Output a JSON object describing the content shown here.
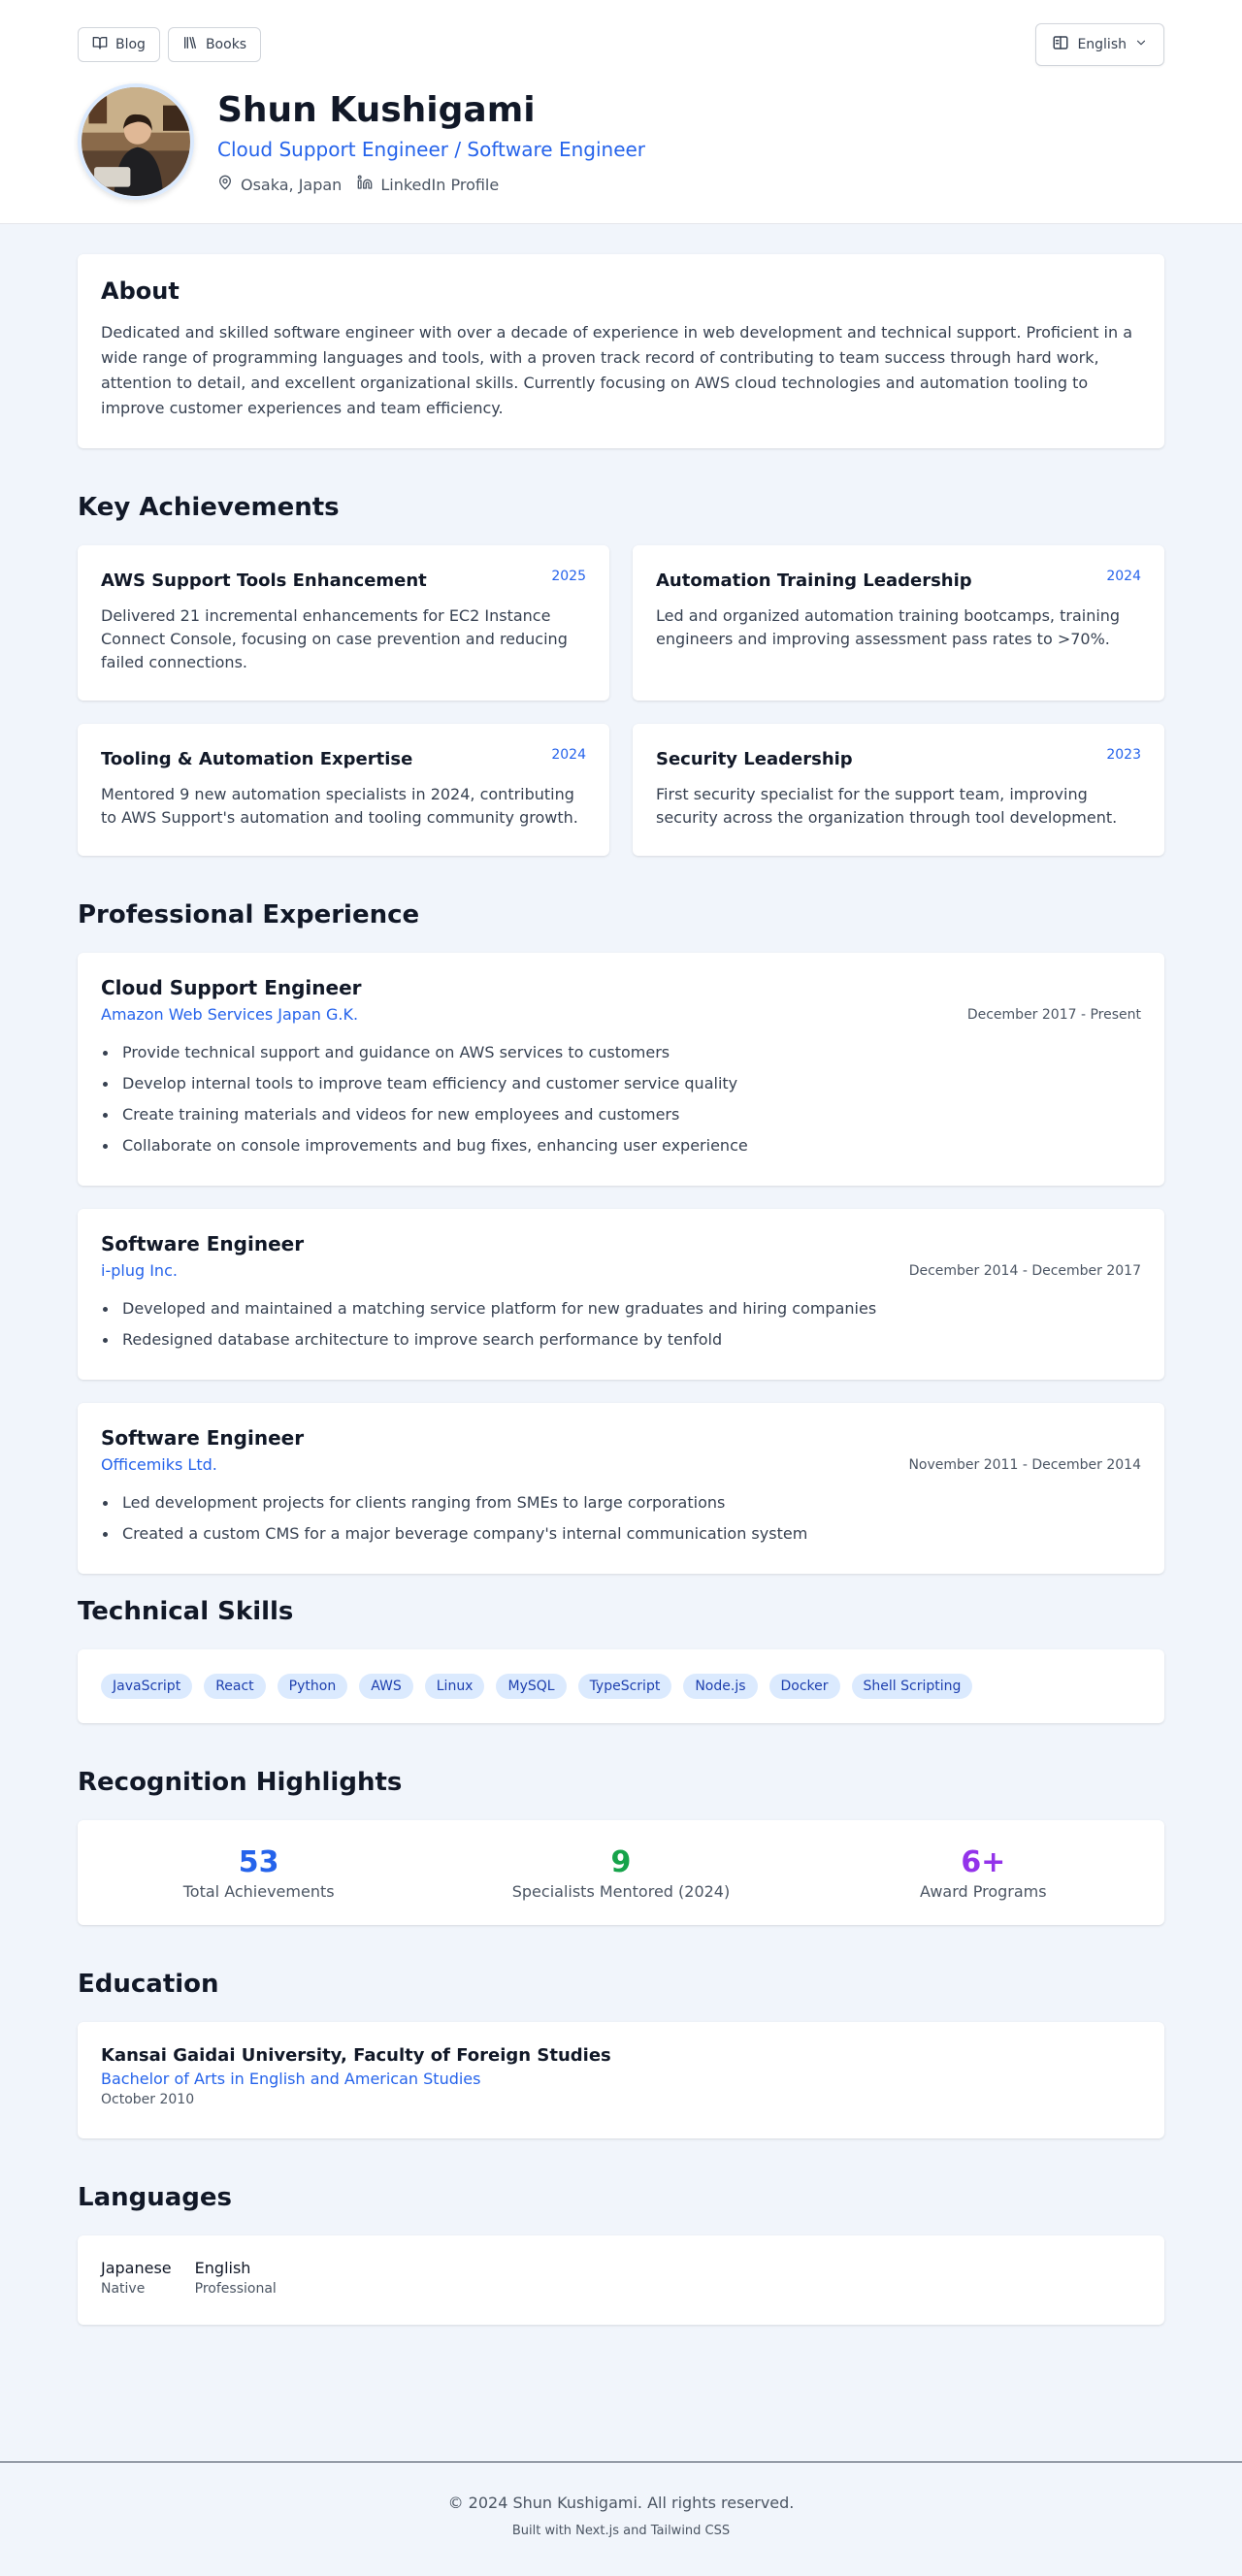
{
  "nav": {
    "blog_label": "Blog",
    "books_label": "Books",
    "language_label": "English"
  },
  "profile": {
    "name": "Shun Kushigami",
    "role": "Cloud Support Engineer / Software Engineer",
    "location": "Osaka, Japan",
    "linkedin": "LinkedIn Profile"
  },
  "about": {
    "title": "About",
    "text": "Dedicated and skilled software engineer with over a decade of experience in web development and technical support. Proficient in a wide range of programming languages and tools, with a proven track record of contributing to team success through hard work, attention to detail, and excellent organizational skills. Currently focusing on AWS cloud technologies and automation tooling to improve customer experiences and team efficiency."
  },
  "achievements": {
    "title": "Key Achievements",
    "items": [
      {
        "title": "AWS Support Tools Enhancement",
        "year": "2025",
        "text": "Delivered 21 incremental enhancements for EC2 Instance Connect Console, focusing on case prevention and reducing failed connections."
      },
      {
        "title": "Automation Training Leadership",
        "year": "2024",
        "text": "Led and organized automation training bootcamps, training engineers and improving assessment pass rates to >70%."
      },
      {
        "title": "Tooling & Automation Expertise",
        "year": "2024",
        "text": "Mentored 9 new automation specialists in 2024, contributing to AWS Support's automation and tooling community growth."
      },
      {
        "title": "Security Leadership",
        "year": "2023",
        "text": "First security specialist for the support team, improving security across the organization through tool development."
      }
    ]
  },
  "experience": {
    "title": "Professional Experience",
    "items": [
      {
        "role": "Cloud Support Engineer",
        "company": "Amazon Web Services Japan G.K.",
        "dates": "December 2017 - Present",
        "bullets": [
          "Provide technical support and guidance on AWS services to customers",
          "Develop internal tools to improve team efficiency and customer service quality",
          "Create training materials and videos for new employees and customers",
          "Collaborate on console improvements and bug fixes, enhancing user experience"
        ]
      },
      {
        "role": "Software Engineer",
        "company": "i-plug Inc.",
        "dates": "December 2014 - December 2017",
        "bullets": [
          "Developed and maintained a matching service platform for new graduates and hiring companies",
          "Redesigned database architecture to improve search performance by tenfold"
        ]
      },
      {
        "role": "Software Engineer",
        "company": "Officemiks Ltd.",
        "dates": "November 2011 - December 2014",
        "bullets": [
          "Led development projects for clients ranging from SMEs to large corporations",
          "Created a custom CMS for a major beverage company's internal communication system"
        ]
      }
    ]
  },
  "skills": {
    "title": "Technical Skills",
    "items": [
      "JavaScript",
      "React",
      "Python",
      "AWS",
      "Linux",
      "MySQL",
      "TypeScript",
      "Node.js",
      "Docker",
      "Shell Scripting"
    ]
  },
  "recognition": {
    "title": "Recognition Highlights",
    "items": [
      {
        "value": "53",
        "label": "Total Achievements",
        "color": "#2563eb"
      },
      {
        "value": "9",
        "label": "Specialists Mentored (2024)",
        "color": "#16a34a"
      },
      {
        "value": "6+",
        "label": "Award Programs",
        "color": "#9333ea"
      }
    ]
  },
  "education": {
    "title": "Education",
    "school": "Kansai Gaidai University, Faculty of Foreign Studies",
    "degree": "Bachelor of Arts in English and American Studies",
    "date": "October 2010"
  },
  "languages": {
    "title": "Languages",
    "items": [
      {
        "name": "Japanese",
        "level": "Native"
      },
      {
        "name": "English",
        "level": "Professional"
      }
    ]
  },
  "footer": {
    "copyright": "© 2024 Shun Kushigami. All rights reserved.",
    "built_with": "Built with Next.js and Tailwind CSS"
  }
}
